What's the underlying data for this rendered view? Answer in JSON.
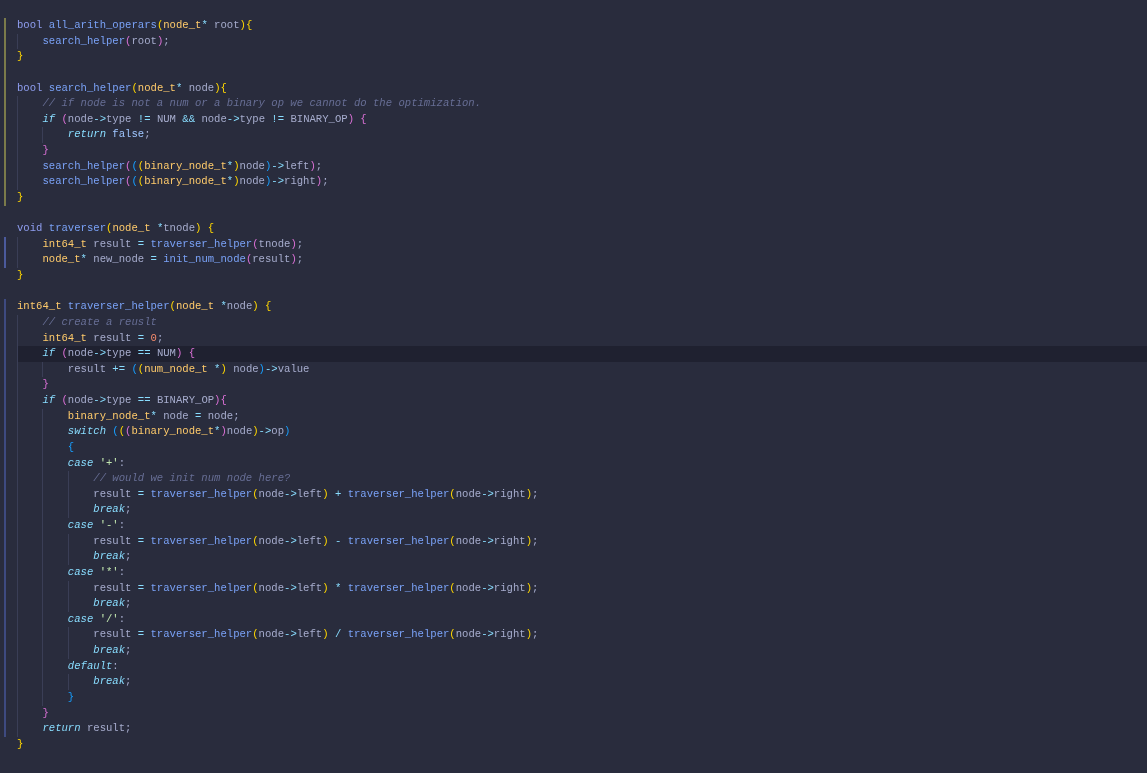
{
  "lines": [
    {
      "color": "#7a7a4a",
      "current": false,
      "tokens": [
        {
          "kind": "decl",
          "text": "bool "
        },
        {
          "kind": "fn",
          "text": "all_arith_operars"
        },
        {
          "kind": "p1",
          "text": "("
        },
        {
          "kind": "type",
          "text": "node_t"
        },
        {
          "kind": "op",
          "text": "*"
        },
        {
          "kind": "plain",
          "text": " root"
        },
        {
          "kind": "p1",
          "text": "){"
        }
      ],
      "children": [
        {
          "color": "#7a7a4a",
          "current": false,
          "tokens": [
            {
              "kind": "fn",
              "text": "search_helper"
            },
            {
              "kind": "p2",
              "text": "("
            },
            {
              "kind": "plain",
              "text": "root"
            },
            {
              "kind": "p2",
              "text": ")"
            },
            {
              "kind": "plain",
              "text": ";"
            }
          ]
        }
      ]
    },
    {
      "color": "#7a7a4a",
      "current": false,
      "tokens": [
        {
          "kind": "p1",
          "text": "}"
        }
      ]
    },
    {
      "color": "#7a7a4a",
      "current": false
    },
    {
      "color": "#7a7a4a",
      "current": false,
      "tokens": [
        {
          "kind": "decl",
          "text": "bool "
        },
        {
          "kind": "fn",
          "text": "search_helper"
        },
        {
          "kind": "p1",
          "text": "("
        },
        {
          "kind": "type",
          "text": "node_t"
        },
        {
          "kind": "op",
          "text": "*"
        },
        {
          "kind": "plain",
          "text": " node"
        },
        {
          "kind": "p1",
          "text": "){"
        }
      ],
      "children": [
        {
          "color": "#7a7a4a",
          "current": false,
          "tokens": [
            {
              "kind": "comment",
              "text": "// if node is not a num or a binary op we cannot do the optimization."
            }
          ]
        },
        {
          "color": "#7a7a4a",
          "current": false,
          "tokens": [
            {
              "kind": "ctl",
              "text": "if "
            },
            {
              "kind": "p2",
              "text": "("
            },
            {
              "kind": "plain",
              "text": "node"
            },
            {
              "kind": "op",
              "text": "->"
            },
            {
              "kind": "plain",
              "text": "type "
            },
            {
              "kind": "op",
              "text": "!="
            },
            {
              "kind": "plain",
              "text": " NUM "
            },
            {
              "kind": "op",
              "text": "&&"
            },
            {
              "kind": "plain",
              "text": " node"
            },
            {
              "kind": "op",
              "text": "->"
            },
            {
              "kind": "plain",
              "text": "type "
            },
            {
              "kind": "op",
              "text": "!="
            },
            {
              "kind": "plain",
              "text": " BINARY_OP"
            },
            {
              "kind": "p2",
              "text": ") {"
            }
          ],
          "children": [
            {
              "color": "#7a7a4a",
              "current": false,
              "tokens": [
                {
                  "kind": "ctl",
                  "text": "return "
                },
                {
                  "kind": "const",
                  "text": "false"
                },
                {
                  "kind": "plain",
                  "text": ";"
                }
              ]
            }
          ]
        },
        {
          "color": "#7a7a4a",
          "current": false,
          "tokens": [
            {
              "kind": "p2",
              "text": "}"
            }
          ]
        },
        {
          "color": "#7a7a4a",
          "current": false,
          "tokens": [
            {
              "kind": "fn",
              "text": "search_helper"
            },
            {
              "kind": "p2",
              "text": "("
            },
            {
              "kind": "p3",
              "text": "("
            },
            {
              "kind": "p1",
              "text": "("
            },
            {
              "kind": "type",
              "text": "binary_node_t"
            },
            {
              "kind": "op",
              "text": "*"
            },
            {
              "kind": "p1",
              "text": ")"
            },
            {
              "kind": "plain",
              "text": "node"
            },
            {
              "kind": "p3",
              "text": ")"
            },
            {
              "kind": "op",
              "text": "->"
            },
            {
              "kind": "plain",
              "text": "left"
            },
            {
              "kind": "p2",
              "text": ")"
            },
            {
              "kind": "plain",
              "text": ";"
            }
          ]
        },
        {
          "color": "#7a7a4a",
          "current": false,
          "tokens": [
            {
              "kind": "fn",
              "text": "search_helper"
            },
            {
              "kind": "p2",
              "text": "("
            },
            {
              "kind": "p3",
              "text": "("
            },
            {
              "kind": "p1",
              "text": "("
            },
            {
              "kind": "type",
              "text": "binary_node_t"
            },
            {
              "kind": "op",
              "text": "*"
            },
            {
              "kind": "p1",
              "text": ")"
            },
            {
              "kind": "plain",
              "text": "node"
            },
            {
              "kind": "p3",
              "text": ")"
            },
            {
              "kind": "op",
              "text": "->"
            },
            {
              "kind": "plain",
              "text": "right"
            },
            {
              "kind": "p2",
              "text": ")"
            },
            {
              "kind": "plain",
              "text": ";"
            }
          ]
        }
      ]
    },
    {
      "color": "#7a7a4a",
      "current": false,
      "tokens": [
        {
          "kind": "p1",
          "text": "}"
        }
      ]
    },
    {
      "current": false
    },
    {
      "current": false,
      "tokens": [
        {
          "kind": "decl",
          "text": "void "
        },
        {
          "kind": "fn",
          "text": "traverser"
        },
        {
          "kind": "p1",
          "text": "("
        },
        {
          "kind": "type",
          "text": "node_t "
        },
        {
          "kind": "op",
          "text": "*"
        },
        {
          "kind": "plain",
          "text": "tnode"
        },
        {
          "kind": "p1",
          "text": ") {"
        }
      ],
      "children": [
        {
          "color": "#4b5a9c",
          "current": false,
          "tokens": [
            {
              "kind": "type",
              "text": "int64_t"
            },
            {
              "kind": "plain",
              "text": " result "
            },
            {
              "kind": "op",
              "text": "= "
            },
            {
              "kind": "fn",
              "text": "traverser_helper"
            },
            {
              "kind": "p2",
              "text": "("
            },
            {
              "kind": "plain",
              "text": "tnode"
            },
            {
              "kind": "p2",
              "text": ")"
            },
            {
              "kind": "plain",
              "text": ";"
            }
          ]
        },
        {
          "color": "#4b5a9c",
          "current": false,
          "tokens": [
            {
              "kind": "type",
              "text": "node_t"
            },
            {
              "kind": "op",
              "text": "*"
            },
            {
              "kind": "plain",
              "text": " new_node "
            },
            {
              "kind": "op",
              "text": "= "
            },
            {
              "kind": "fn",
              "text": "init_num_node"
            },
            {
              "kind": "p2",
              "text": "("
            },
            {
              "kind": "plain",
              "text": "result"
            },
            {
              "kind": "p2",
              "text": ")"
            },
            {
              "kind": "plain",
              "text": ";"
            }
          ]
        }
      ]
    },
    {
      "current": false,
      "tokens": [
        {
          "kind": "p1",
          "text": "}"
        }
      ]
    },
    {
      "current": false
    },
    {
      "color": "#3e4a80",
      "current": false,
      "tokens": [
        {
          "kind": "type",
          "text": "int64_t "
        },
        {
          "kind": "fn",
          "text": "traverser_helper"
        },
        {
          "kind": "p1",
          "text": "("
        },
        {
          "kind": "type",
          "text": "node_t "
        },
        {
          "kind": "op",
          "text": "*"
        },
        {
          "kind": "plain",
          "text": "node"
        },
        {
          "kind": "p1",
          "text": ") {"
        }
      ],
      "children": [
        {
          "color": "#3e4a80",
          "current": false,
          "tokens": [
            {
              "kind": "comment",
              "text": "// create a reuslt"
            }
          ]
        },
        {
          "color": "#3e4a80",
          "current": false,
          "tokens": [
            {
              "kind": "type",
              "text": "int64_t"
            },
            {
              "kind": "plain",
              "text": " result "
            },
            {
              "kind": "op",
              "text": "= "
            },
            {
              "kind": "num",
              "text": "0"
            },
            {
              "kind": "plain",
              "text": ";"
            }
          ]
        },
        {
          "color": "#3e4a80",
          "current": true,
          "tokens": [
            {
              "kind": "ctl",
              "text": "if "
            },
            {
              "kind": "p2",
              "text": "("
            },
            {
              "kind": "plain",
              "text": "node"
            },
            {
              "kind": "op",
              "text": "->"
            },
            {
              "kind": "plain",
              "text": "type "
            },
            {
              "kind": "op",
              "text": "=="
            },
            {
              "kind": "plain",
              "text": " NUM"
            },
            {
              "kind": "p2",
              "text": ") {"
            }
          ],
          "children": [
            {
              "color": "#3e4a80",
              "current": false,
              "tokens": [
                {
                  "kind": "plain",
                  "text": "result "
                },
                {
                  "kind": "op",
                  "text": "+= "
                },
                {
                  "kind": "p3",
                  "text": "("
                },
                {
                  "kind": "p1",
                  "text": "("
                },
                {
                  "kind": "type",
                  "text": "num_node_t "
                },
                {
                  "kind": "op",
                  "text": "*"
                },
                {
                  "kind": "p1",
                  "text": ")"
                },
                {
                  "kind": "plain",
                  "text": " node"
                },
                {
                  "kind": "p3",
                  "text": ")"
                },
                {
                  "kind": "op",
                  "text": "->"
                },
                {
                  "kind": "plain",
                  "text": "value"
                }
              ]
            }
          ]
        },
        {
          "color": "#3e4a80",
          "current": false,
          "tokens": [
            {
              "kind": "p2",
              "text": "}"
            }
          ]
        },
        {
          "color": "#3e4a80",
          "current": false,
          "tokens": [
            {
              "kind": "ctl",
              "text": "if "
            },
            {
              "kind": "p2",
              "text": "("
            },
            {
              "kind": "plain",
              "text": "node"
            },
            {
              "kind": "op",
              "text": "->"
            },
            {
              "kind": "plain",
              "text": "type "
            },
            {
              "kind": "op",
              "text": "=="
            },
            {
              "kind": "plain",
              "text": " BINARY_OP"
            },
            {
              "kind": "p2",
              "text": "){"
            }
          ],
          "children": [
            {
              "color": "#3e4a80",
              "current": false,
              "tokens": [
                {
                  "kind": "type",
                  "text": "binary_node_t"
                },
                {
                  "kind": "op",
                  "text": "*"
                },
                {
                  "kind": "plain",
                  "text": " node "
                },
                {
                  "kind": "op",
                  "text": "="
                },
                {
                  "kind": "plain",
                  "text": " node;"
                }
              ]
            },
            {
              "color": "#3e4a80",
              "current": false,
              "tokens": [
                {
                  "kind": "ctl",
                  "text": "switch "
                },
                {
                  "kind": "p3",
                  "text": "("
                },
                {
                  "kind": "p1",
                  "text": "("
                },
                {
                  "kind": "p2",
                  "text": "("
                },
                {
                  "kind": "type",
                  "text": "binary_node_t"
                },
                {
                  "kind": "op",
                  "text": "*"
                },
                {
                  "kind": "p2",
                  "text": ")"
                },
                {
                  "kind": "plain",
                  "text": "node"
                },
                {
                  "kind": "p1",
                  "text": ")"
                },
                {
                  "kind": "op",
                  "text": "->"
                },
                {
                  "kind": "plain",
                  "text": "op"
                },
                {
                  "kind": "p3",
                  "text": ")"
                }
              ]
            },
            {
              "color": "#3e4a80",
              "current": false,
              "tokens": [
                {
                  "kind": "p3",
                  "text": "{"
                }
              ]
            },
            {
              "color": "#3e4a80",
              "current": false,
              "tokens": [
                {
                  "kind": "ctl",
                  "text": "case "
                },
                {
                  "kind": "str",
                  "text": "'+'"
                },
                {
                  "kind": "plain",
                  "text": ":"
                }
              ],
              "children": [
                {
                  "color": "#3e4a80",
                  "current": false,
                  "tokens": [
                    {
                      "kind": "comment",
                      "text": "// would we init num node here?"
                    }
                  ]
                },
                {
                  "color": "#3e4a80",
                  "current": false,
                  "tokens": [
                    {
                      "kind": "plain",
                      "text": "result "
                    },
                    {
                      "kind": "op",
                      "text": "= "
                    },
                    {
                      "kind": "fn",
                      "text": "traverser_helper"
                    },
                    {
                      "kind": "p1",
                      "text": "("
                    },
                    {
                      "kind": "plain",
                      "text": "node"
                    },
                    {
                      "kind": "op",
                      "text": "->"
                    },
                    {
                      "kind": "plain",
                      "text": "left"
                    },
                    {
                      "kind": "p1",
                      "text": ") "
                    },
                    {
                      "kind": "op",
                      "text": "+ "
                    },
                    {
                      "kind": "fn",
                      "text": "traverser_helper"
                    },
                    {
                      "kind": "p1",
                      "text": "("
                    },
                    {
                      "kind": "plain",
                      "text": "node"
                    },
                    {
                      "kind": "op",
                      "text": "->"
                    },
                    {
                      "kind": "plain",
                      "text": "right"
                    },
                    {
                      "kind": "p1",
                      "text": ")"
                    },
                    {
                      "kind": "plain",
                      "text": ";"
                    }
                  ]
                },
                {
                  "color": "#3e4a80",
                  "current": false,
                  "tokens": [
                    {
                      "kind": "ctl",
                      "text": "break"
                    },
                    {
                      "kind": "plain",
                      "text": ";"
                    }
                  ]
                }
              ]
            },
            {
              "color": "#3e4a80",
              "current": false,
              "tokens": [
                {
                  "kind": "ctl",
                  "text": "case "
                },
                {
                  "kind": "str",
                  "text": "'-'"
                },
                {
                  "kind": "plain",
                  "text": ":"
                }
              ],
              "children": [
                {
                  "color": "#3e4a80",
                  "current": false,
                  "tokens": [
                    {
                      "kind": "plain",
                      "text": "result "
                    },
                    {
                      "kind": "op",
                      "text": "= "
                    },
                    {
                      "kind": "fn",
                      "text": "traverser_helper"
                    },
                    {
                      "kind": "p1",
                      "text": "("
                    },
                    {
                      "kind": "plain",
                      "text": "node"
                    },
                    {
                      "kind": "op",
                      "text": "->"
                    },
                    {
                      "kind": "plain",
                      "text": "left"
                    },
                    {
                      "kind": "p1",
                      "text": ") "
                    },
                    {
                      "kind": "op",
                      "text": "- "
                    },
                    {
                      "kind": "fn",
                      "text": "traverser_helper"
                    },
                    {
                      "kind": "p1",
                      "text": "("
                    },
                    {
                      "kind": "plain",
                      "text": "node"
                    },
                    {
                      "kind": "op",
                      "text": "->"
                    },
                    {
                      "kind": "plain",
                      "text": "right"
                    },
                    {
                      "kind": "p1",
                      "text": ")"
                    },
                    {
                      "kind": "plain",
                      "text": ";"
                    }
                  ]
                },
                {
                  "color": "#3e4a80",
                  "current": false,
                  "tokens": [
                    {
                      "kind": "ctl",
                      "text": "break"
                    },
                    {
                      "kind": "plain",
                      "text": ";"
                    }
                  ]
                }
              ]
            },
            {
              "color": "#3e4a80",
              "current": false,
              "tokens": [
                {
                  "kind": "ctl",
                  "text": "case "
                },
                {
                  "kind": "str",
                  "text": "'*'"
                },
                {
                  "kind": "plain",
                  "text": ":"
                }
              ],
              "children": [
                {
                  "color": "#3e4a80",
                  "current": false,
                  "tokens": [
                    {
                      "kind": "plain",
                      "text": "result "
                    },
                    {
                      "kind": "op",
                      "text": "= "
                    },
                    {
                      "kind": "fn",
                      "text": "traverser_helper"
                    },
                    {
                      "kind": "p1",
                      "text": "("
                    },
                    {
                      "kind": "plain",
                      "text": "node"
                    },
                    {
                      "kind": "op",
                      "text": "->"
                    },
                    {
                      "kind": "plain",
                      "text": "left"
                    },
                    {
                      "kind": "p1",
                      "text": ") "
                    },
                    {
                      "kind": "op",
                      "text": "* "
                    },
                    {
                      "kind": "fn",
                      "text": "traverser_helper"
                    },
                    {
                      "kind": "p1",
                      "text": "("
                    },
                    {
                      "kind": "plain",
                      "text": "node"
                    },
                    {
                      "kind": "op",
                      "text": "->"
                    },
                    {
                      "kind": "plain",
                      "text": "right"
                    },
                    {
                      "kind": "p1",
                      "text": ")"
                    },
                    {
                      "kind": "plain",
                      "text": ";"
                    }
                  ]
                },
                {
                  "color": "#3e4a80",
                  "current": false,
                  "tokens": [
                    {
                      "kind": "ctl",
                      "text": "break"
                    },
                    {
                      "kind": "plain",
                      "text": ";"
                    }
                  ]
                }
              ]
            },
            {
              "color": "#3e4a80",
              "current": false,
              "tokens": [
                {
                  "kind": "ctl",
                  "text": "case "
                },
                {
                  "kind": "str",
                  "text": "'/'"
                },
                {
                  "kind": "plain",
                  "text": ":"
                }
              ],
              "children": [
                {
                  "color": "#3e4a80",
                  "current": false,
                  "tokens": [
                    {
                      "kind": "plain",
                      "text": "result "
                    },
                    {
                      "kind": "op",
                      "text": "= "
                    },
                    {
                      "kind": "fn",
                      "text": "traverser_helper"
                    },
                    {
                      "kind": "p1",
                      "text": "("
                    },
                    {
                      "kind": "plain",
                      "text": "node"
                    },
                    {
                      "kind": "op",
                      "text": "->"
                    },
                    {
                      "kind": "plain",
                      "text": "left"
                    },
                    {
                      "kind": "p1",
                      "text": ") "
                    },
                    {
                      "kind": "op",
                      "text": "/ "
                    },
                    {
                      "kind": "fn",
                      "text": "traverser_helper"
                    },
                    {
                      "kind": "p1",
                      "text": "("
                    },
                    {
                      "kind": "plain",
                      "text": "node"
                    },
                    {
                      "kind": "op",
                      "text": "->"
                    },
                    {
                      "kind": "plain",
                      "text": "right"
                    },
                    {
                      "kind": "p1",
                      "text": ")"
                    },
                    {
                      "kind": "plain",
                      "text": ";"
                    }
                  ]
                },
                {
                  "color": "#3e4a80",
                  "current": false,
                  "tokens": [
                    {
                      "kind": "ctl",
                      "text": "break"
                    },
                    {
                      "kind": "plain",
                      "text": ";"
                    }
                  ]
                }
              ]
            },
            {
              "color": "#3e4a80",
              "current": false,
              "tokens": [
                {
                  "kind": "ctl",
                  "text": "default"
                },
                {
                  "kind": "plain",
                  "text": ":"
                }
              ],
              "children": [
                {
                  "color": "#3e4a80",
                  "current": false,
                  "tokens": [
                    {
                      "kind": "ctl",
                      "text": "break"
                    },
                    {
                      "kind": "plain",
                      "text": ";"
                    }
                  ]
                }
              ]
            },
            {
              "color": "#3e4a80",
              "current": false,
              "tokens": [
                {
                  "kind": "p3",
                  "text": "}"
                }
              ]
            }
          ]
        },
        {
          "color": "#3e4a80",
          "current": false,
          "tokens": [
            {
              "kind": "p2",
              "text": "}"
            }
          ]
        },
        {
          "color": "#3e4a80",
          "current": false,
          "tokens": [
            {
              "kind": "ctl",
              "text": "return "
            },
            {
              "kind": "plain",
              "text": "result;"
            }
          ]
        }
      ]
    },
    {
      "current": false,
      "tokens": [
        {
          "kind": "p1",
          "text": "}"
        }
      ]
    }
  ]
}
